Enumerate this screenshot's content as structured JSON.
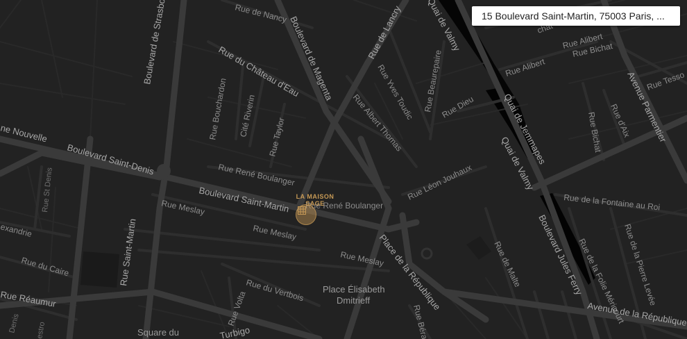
{
  "search": {
    "address": "15 Boulevard Saint-Martin, 75003 Paris, ..."
  },
  "marker": {
    "label": "LA MAISON SAGE"
  },
  "streets": {
    "rue_de_nancy": "Rue de Nancy",
    "bd_strasbourg": "Boulevard de Strasbourg",
    "bd_magenta": "Boulevard de Magenta",
    "rue_lancry": "Rue de Lancry",
    "quai_valmy_top": "Quai de Valmy",
    "rue_chateau_eau": "Rue du Château d'Eau",
    "rue_yves_toudic": "Rue Yves Toudic",
    "rue_beaurepaire": "Rue Beaurepaire",
    "rue_bouchardon": "Rue Bouchardon",
    "cite_riverin": "Cité Riverin",
    "rue_taylor": "Rue Taylor",
    "rue_albert_thomas": "Rue Albert Thomas",
    "rue_dieu": "Rue Dieu",
    "quai_jemmapes": "Quai de Jemmapes",
    "quai_valmy": "Quai de Valmy",
    "rue_alibert_1": "Rue Alibert",
    "rue_alibert_2": "Rue Alibert",
    "chat_fragment": "chat",
    "av_parmentier": "Avenue Parmentier",
    "rue_tesso": "Rue Tesso",
    "rue_bichat_1": "Rue Bichat",
    "rue_bichat_2": "Rue Bichat",
    "rue_aix": "Rue d'Aix",
    "ne_nouvelle": "ne Nouvelle",
    "bd_saint_denis": "Boulevard Saint-Denis",
    "rue_rene_boulanger_1": "Rue René Boulanger",
    "rue_rene_boulanger_2": "Rue René Boulanger",
    "rue_leon_jouhaux": "Rue Léon Jouhaux",
    "rue_st_denis": "Rue St Denis",
    "bd_saint_martin": "Boulevard Saint-Martin",
    "rue_meslay_1": "Rue Meslay",
    "rue_meslay_2": "Rue Meslay",
    "rue_meslay_3": "Rue Meslay",
    "rue_fontaine_roi": "Rue de la Fontaine au Roi",
    "exandrie": "exandrie",
    "rue_saint_martin": "Rue Saint-Martin",
    "place_republique": "Place de la République",
    "bd_jules_ferry": "Boulevard Jules Ferry",
    "rue_folie_mericourt": "Rue de la Folie Méricourt",
    "rue_pierre_levee": "Rue de la Pierre Levée",
    "rue_malte": "Rue de Malte",
    "rue_du_caire": "Rue du Caire",
    "rue_reaumur": "Rue Réaumur",
    "rue_volta": "Rue Volta",
    "rue_vertbois": "Rue du Vertbois",
    "place_elisabeth_1": "Place Élisabeth",
    "place_elisabeth_2": "Dmitrieff",
    "av_republique": "Avenue de la République",
    "square_du": "Square du",
    "turbigo": "Turbigo",
    "rue_bera": "Rue Béra",
    "denis_fragment": "Denis",
    "estro_fragment": "estro"
  }
}
